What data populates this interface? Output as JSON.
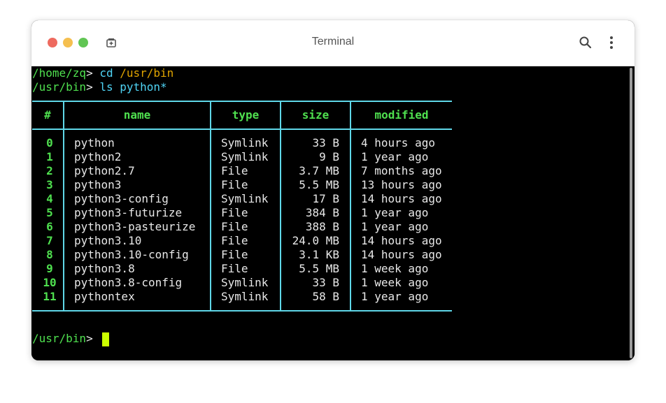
{
  "window": {
    "title": "Terminal"
  },
  "terminal": {
    "lines": [
      {
        "path": "/home/zq",
        "prompt_char": ">",
        "command": "cd",
        "argument": "/usr/bin"
      },
      {
        "path": "/usr/bin",
        "prompt_char": ">",
        "command": "ls",
        "argument": "python*"
      }
    ],
    "table": {
      "headers": [
        "#",
        "name",
        "type",
        "size",
        "modified"
      ],
      "rows": [
        {
          "idx": "0",
          "name": "python",
          "type": "Symlink",
          "size": "33 B",
          "modified": "4 hours ago"
        },
        {
          "idx": "1",
          "name": "python2",
          "type": "Symlink",
          "size": "9 B",
          "modified": "1 year ago"
        },
        {
          "idx": "2",
          "name": "python2.7",
          "type": "File",
          "size": "3.7 MB",
          "modified": "7 months ago"
        },
        {
          "idx": "3",
          "name": "python3",
          "type": "File",
          "size": "5.5 MB",
          "modified": "13 hours ago"
        },
        {
          "idx": "4",
          "name": "python3-config",
          "type": "Symlink",
          "size": "17 B",
          "modified": "14 hours ago"
        },
        {
          "idx": "5",
          "name": "python3-futurize",
          "type": "File",
          "size": "384 B",
          "modified": "1 year ago"
        },
        {
          "idx": "6",
          "name": "python3-pasteurize",
          "type": "File",
          "size": "388 B",
          "modified": "1 year ago"
        },
        {
          "idx": "7",
          "name": "python3.10",
          "type": "File",
          "size": "24.0 MB",
          "modified": "14 hours ago"
        },
        {
          "idx": "8",
          "name": "python3.10-config",
          "type": "File",
          "size": "3.1 KB",
          "modified": "14 hours ago"
        },
        {
          "idx": "9",
          "name": "python3.8",
          "type": "File",
          "size": "5.5 MB",
          "modified": "1 week ago"
        },
        {
          "idx": "10",
          "name": "python3.8-config",
          "type": "Symlink",
          "size": "33 B",
          "modified": "1 week ago"
        },
        {
          "idx": "11",
          "name": "pythontex",
          "type": "Symlink",
          "size": "58 B",
          "modified": "1 year ago"
        }
      ]
    },
    "current_prompt": {
      "path": "/usr/bin",
      "prompt_char": ">"
    }
  },
  "icons": {
    "new_tab": "new-tab-icon",
    "search": "search-icon",
    "menu": "kebab-menu-icon"
  },
  "colors": {
    "path": "#4fe04f",
    "command": "#4fd4f5",
    "argument": "#e0a400",
    "table_border": "#5fd7e8",
    "cursor": "#ccff00"
  }
}
